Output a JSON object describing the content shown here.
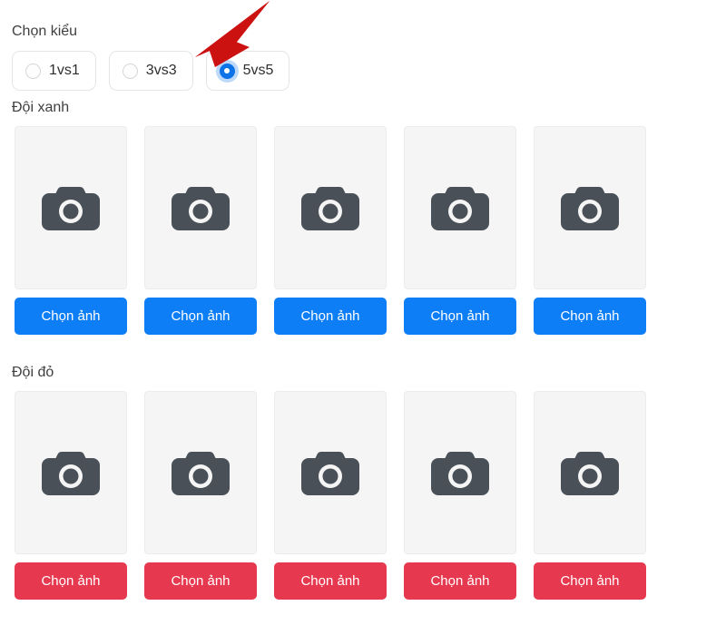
{
  "mode_section": {
    "label": "Chọn kiểu",
    "options": [
      {
        "label": "1vs1",
        "selected": false
      },
      {
        "label": "3vs3",
        "selected": false
      },
      {
        "label": "5vs5",
        "selected": true
      }
    ]
  },
  "teams": [
    {
      "key": "blue",
      "label": "Đội xanh",
      "button_color": "#0d7ef5",
      "slots": [
        {
          "placeholder_icon": "camera-icon",
          "button_label": "Chọn ảnh"
        },
        {
          "placeholder_icon": "camera-icon",
          "button_label": "Chọn ảnh"
        },
        {
          "placeholder_icon": "camera-icon",
          "button_label": "Chọn ảnh"
        },
        {
          "placeholder_icon": "camera-icon",
          "button_label": "Chọn ảnh"
        },
        {
          "placeholder_icon": "camera-icon",
          "button_label": "Chọn ảnh"
        }
      ]
    },
    {
      "key": "red",
      "label": "Đội đỏ",
      "button_color": "#e63950",
      "slots": [
        {
          "placeholder_icon": "camera-icon",
          "button_label": "Chọn ảnh"
        },
        {
          "placeholder_icon": "camera-icon",
          "button_label": "Chọn ảnh"
        },
        {
          "placeholder_icon": "camera-icon",
          "button_label": "Chọn ảnh"
        },
        {
          "placeholder_icon": "camera-icon",
          "button_label": "Chọn ảnh"
        },
        {
          "placeholder_icon": "camera-icon",
          "button_label": "Chọn ảnh"
        }
      ]
    }
  ],
  "annotation": {
    "icon": "arrow-icon",
    "color": "#cc1111",
    "points_to": "5vs5"
  },
  "colors": {
    "accent_blue": "#0d7ef5",
    "accent_red": "#e63950",
    "radio_selected": "#0b72e8",
    "thumb_background": "#f5f5f5",
    "camera_icon": "#4a5057"
  }
}
